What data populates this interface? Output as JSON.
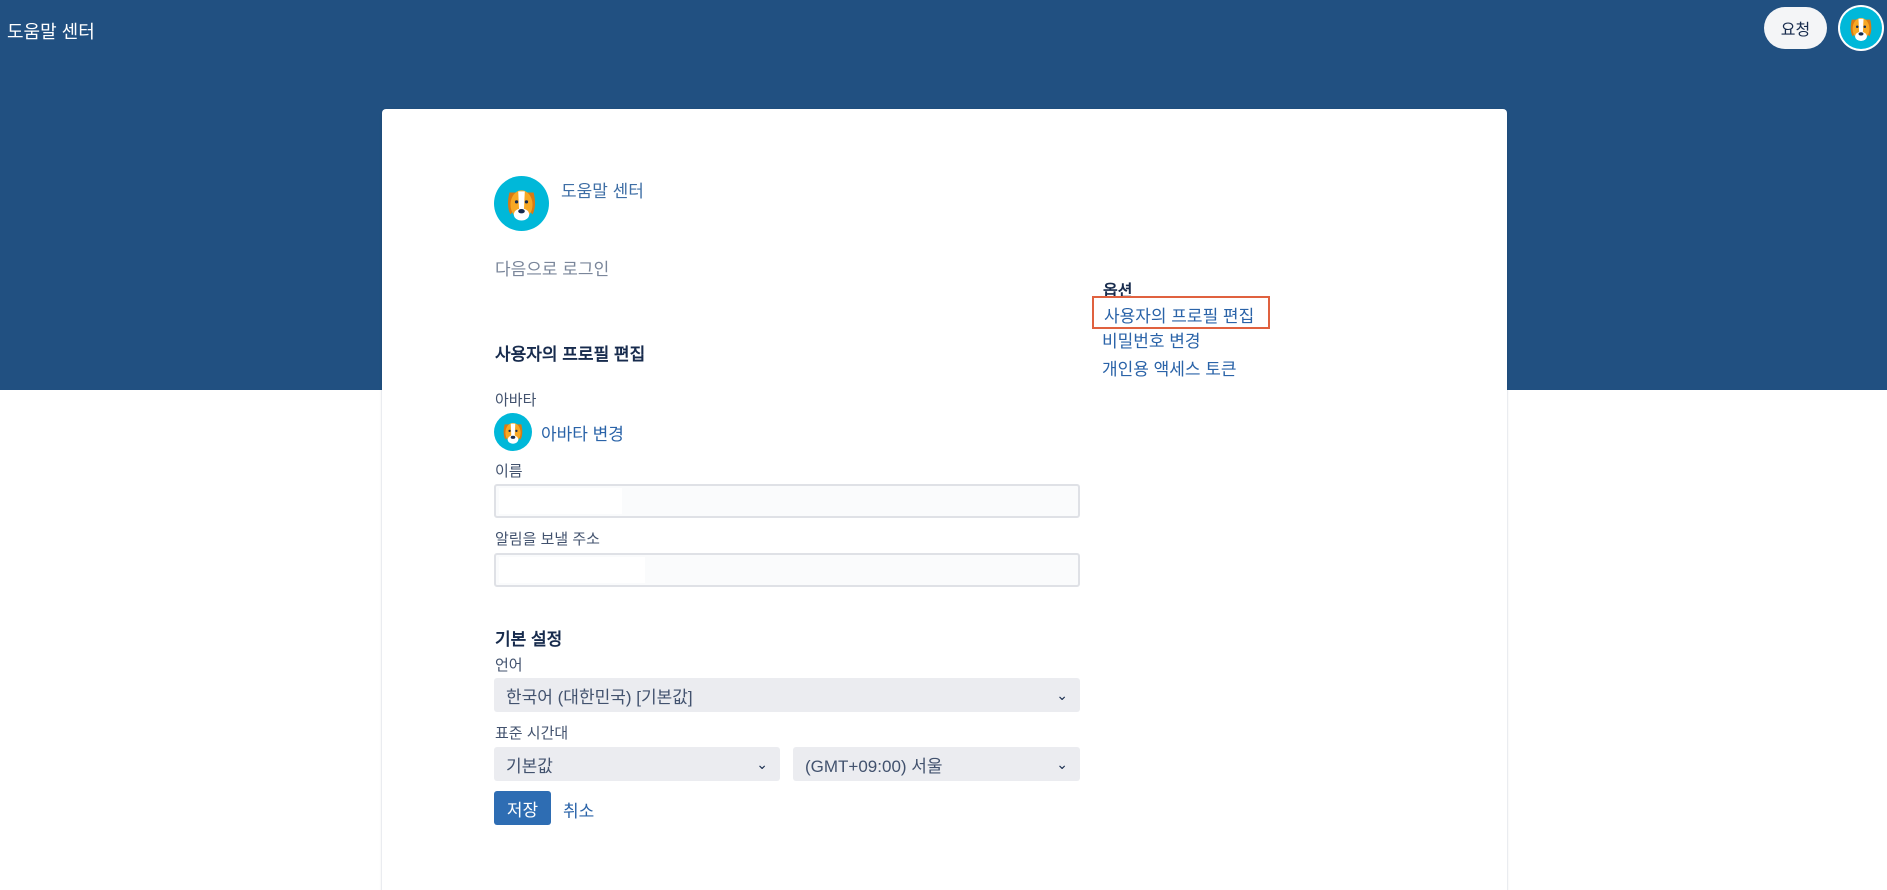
{
  "header": {
    "brand": "도움말 센터",
    "request_button": "요청",
    "avatar_icon": "dog-avatar-icon"
  },
  "card": {
    "brand": "도움말 센터",
    "login_as_label": "다음으로 로그인",
    "options": {
      "heading": "옵션",
      "items": [
        "사용자의 프로필 편집",
        "비밀번호 변경",
        "개인용 액세스 토큰"
      ]
    },
    "profile": {
      "title": "사용자의 프로필 편집",
      "avatar_label": "아바타",
      "change_avatar": "아바타 변경",
      "name_label": "이름",
      "email_label": "알림을 보낼 주소"
    },
    "preferences": {
      "title": "기본 설정",
      "language_label": "언어",
      "language_value": "한국어 (대한민국) [기본값]",
      "timezone_label": "표준 시간대",
      "timezone_region_value": "기본값",
      "timezone_value": "(GMT+09:00) 서울"
    },
    "save_button": "저장",
    "cancel_link": "취소"
  },
  "colors": {
    "header_bg": "#215081",
    "link": "#2a63a8",
    "primary_button": "#2e6db3",
    "highlight_border": "#e0613f",
    "avatar_bg": "#00b8d9"
  }
}
